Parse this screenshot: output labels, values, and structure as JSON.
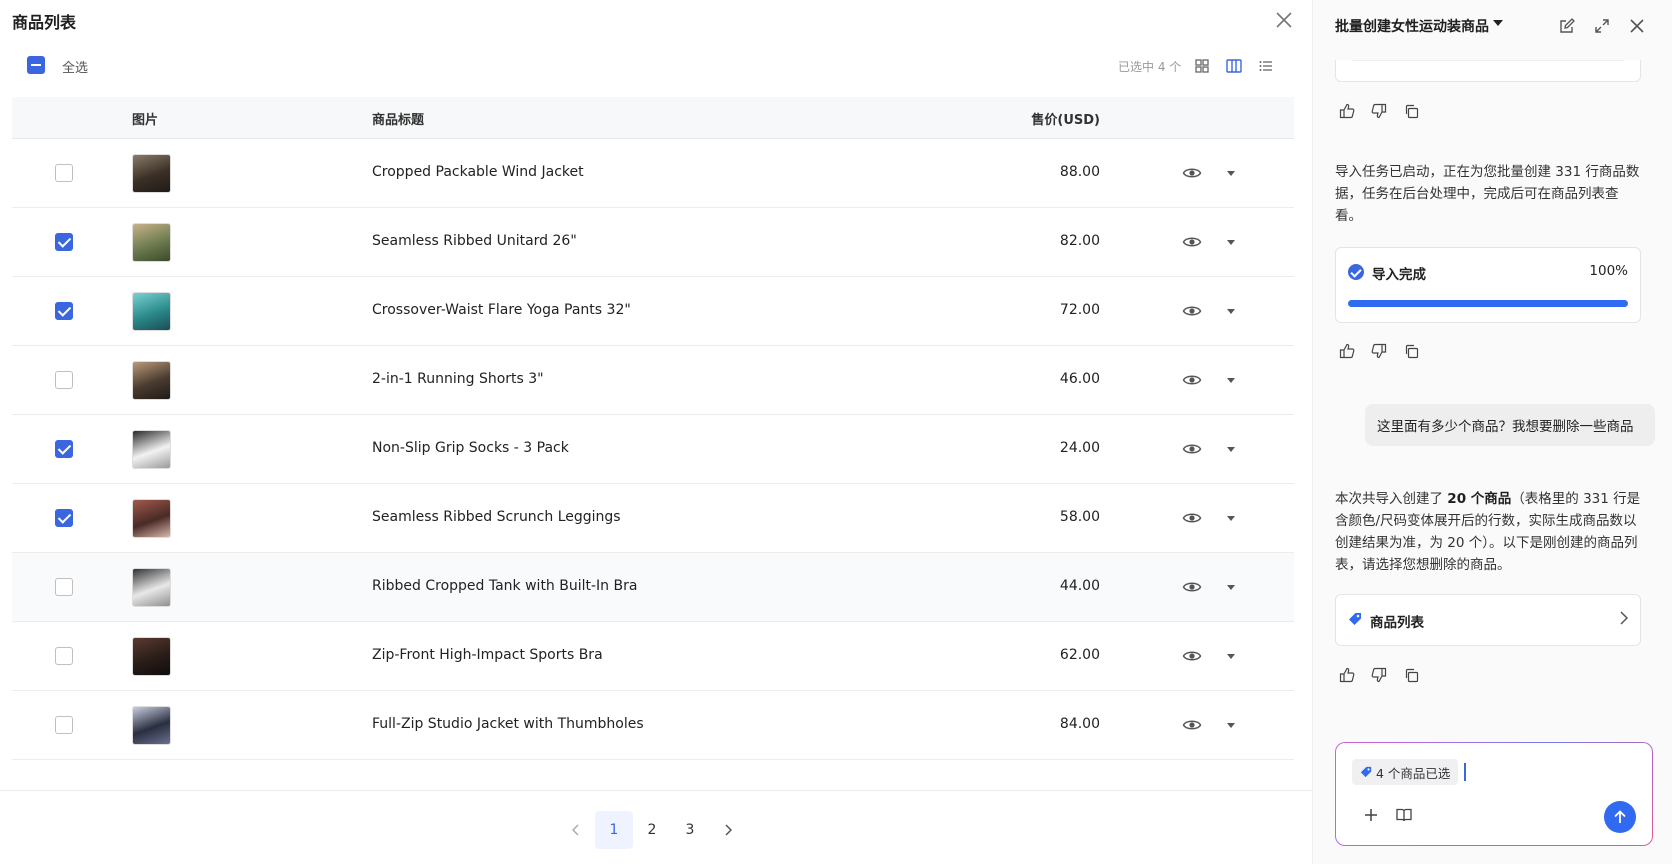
{
  "product_panel": {
    "title": "商品列表",
    "select_all_label": "全选",
    "selected_count_text": "已选中 4 个",
    "columns": {
      "image": "图片",
      "title": "商品标题",
      "price": "售价(USD)"
    },
    "rows": [
      {
        "checked": false,
        "title": "Cropped Packable Wind Jacket",
        "price": "88.00",
        "thumb": [
          "#3b3026",
          "#8a7c6a",
          "#1e1a17"
        ]
      },
      {
        "checked": true,
        "title": "Seamless Ribbed Unitard 26\"",
        "price": "82.00",
        "thumb": [
          "#6d7b4f",
          "#c9b28a",
          "#3c4a2c"
        ]
      },
      {
        "checked": true,
        "title": "Crossover-Waist Flare Yoga Pants 32\"",
        "price": "72.00",
        "thumb": [
          "#2b8a8a",
          "#7ad1d3",
          "#1c4c56"
        ]
      },
      {
        "checked": false,
        "title": "2-in-1 Running Shorts 3\"",
        "price": "46.00",
        "thumb": [
          "#4a3b30",
          "#b99a7a",
          "#1f1b18"
        ]
      },
      {
        "checked": true,
        "title": "Non-Slip Grip Socks - 3 Pack",
        "price": "24.00",
        "thumb": [
          "#f2f2f2",
          "#2a2a2a",
          "#9a9a9a"
        ]
      },
      {
        "checked": true,
        "title": "Seamless Ribbed Scrunch Leggings",
        "price": "58.00",
        "thumb": [
          "#4a2a26",
          "#a15a4c",
          "#d8b8a8"
        ]
      },
      {
        "checked": false,
        "title": "Ribbed Cropped Tank with Built-In Bra",
        "price": "44.00",
        "thumb": [
          "#e8e8e8",
          "#333333",
          "#8f8f8f"
        ]
      },
      {
        "checked": false,
        "title": "Zip-Front High-Impact Sports Bra",
        "price": "62.00",
        "thumb": [
          "#2a1d18",
          "#5a3a30",
          "#0f0d0c"
        ]
      },
      {
        "checked": false,
        "title": "Full-Zip Studio Jacket with Thumbholes",
        "price": "84.00",
        "thumb": [
          "#2a2f40",
          "#c9cde0",
          "#6b7090"
        ]
      }
    ],
    "pagination": {
      "pages": [
        "1",
        "2",
        "3"
      ],
      "current": "1"
    }
  },
  "chat_panel": {
    "title": "批量创建女性运动装商品",
    "messages": {
      "import_started": "导入任务已启动，正在为您批量创建 331 行商品数据，任务在后台处理中，完成后可在商品列表查看。",
      "progress_label": "导入完成",
      "progress_percent": "100%",
      "progress_value": 1.0,
      "user_question": "这里面有多少个商品？我想要删除一些商品",
      "answer_prefix": "本次共导入创建了 ",
      "answer_bold": "20 个商品",
      "answer_suffix": "（表格里的 331 行是含颜色/尺码变体展开后的行数，实际生成商品数以创建结果为准，为 20 个）。以下是刚创建的商品列表，请选择您想删除的商品。",
      "link_card_label": "商品列表"
    },
    "composer": {
      "chip_label": "4 个商品已选"
    }
  },
  "colors": {
    "accent": "#3a66e0",
    "progress": "#2f6af0"
  }
}
